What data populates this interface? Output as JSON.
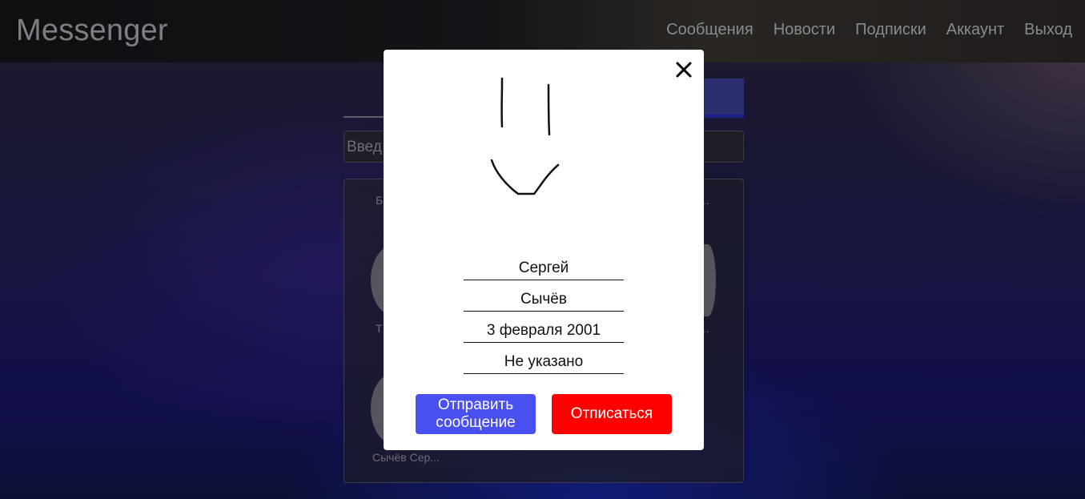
{
  "app": {
    "title": "Messenger"
  },
  "nav": {
    "items": [
      {
        "label": "Сообщения"
      },
      {
        "label": "Новости"
      },
      {
        "label": "Подписки"
      },
      {
        "label": "Аккаунт"
      },
      {
        "label": "Выход"
      }
    ]
  },
  "background": {
    "search_text": "Введ",
    "ghost_texts": [
      "Б",
      "...",
      "Т",
      "...",
      "Сычёв Сер..."
    ]
  },
  "modal": {
    "first_name": "Сергей",
    "last_name": "Сычёв",
    "birth_date": "3 февраля 2001",
    "extra_field": "Не указано",
    "send_button": "Отправить сообщение",
    "unsubscribe_button": "Отписаться",
    "colors": {
      "send": "#4a4ff0",
      "unsubscribe": "#ff0000"
    },
    "icons": {
      "close": "close-icon",
      "avatar": "avatar-drawing"
    }
  }
}
